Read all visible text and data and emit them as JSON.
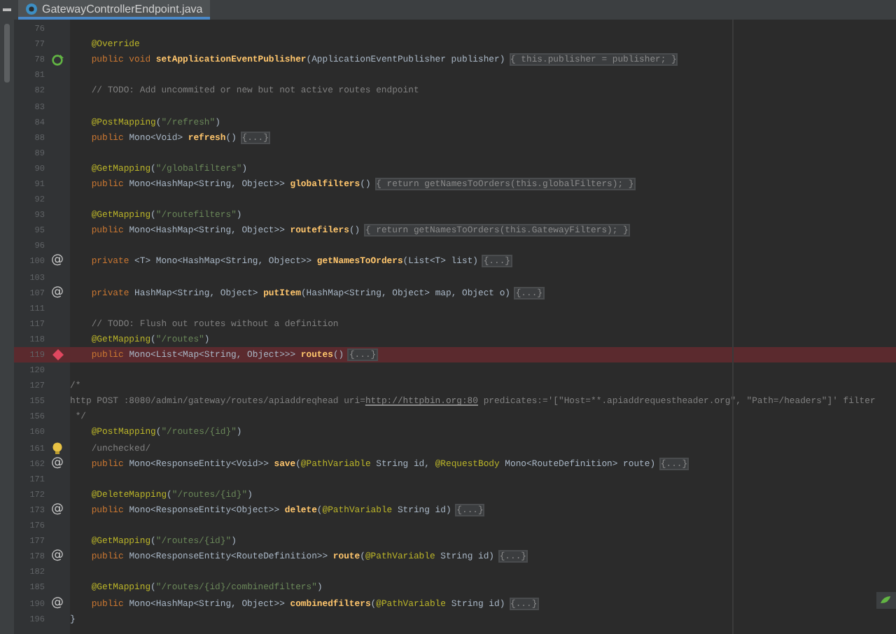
{
  "tabs": [
    {
      "label": "GatewayControllerEndpoint.java",
      "selected": true
    }
  ],
  "lines": [
    {
      "num": "76",
      "highlighted": false
    },
    {
      "num": "77",
      "highlighted": false,
      "tokens": [
        {
          "t": "    @Override",
          "kind": "ann"
        }
      ]
    },
    {
      "num": "78",
      "highlighted": false,
      "gutter": {
        "kind": "override"
      },
      "tokens": [
        {
          "t": "    public void ",
          "kind": "kw"
        },
        {
          "t": "setApplicationEventPublisher",
          "kind": "fn"
        },
        {
          "t": "(ApplicationEventPublisher publisher) ",
          "kind": "p"
        },
        {
          "t": "{ this.publisher = publisher; }",
          "kind": "fold"
        }
      ]
    },
    {
      "num": "81",
      "highlighted": false
    },
    {
      "num": "82",
      "highlighted": false,
      "tokens": [
        {
          "t": "    // TODO: Add uncommited or new but not active routes endpoint",
          "kind": "cm"
        }
      ]
    },
    {
      "num": "83",
      "highlighted": false
    },
    {
      "num": "84",
      "highlighted": false,
      "tokens": [
        {
          "t": "    @PostMapping",
          "kind": "ann"
        },
        {
          "t": "(",
          "kind": "p"
        },
        {
          "t": "\"/refresh\"",
          "kind": "str"
        },
        {
          "t": ")",
          "kind": "p"
        }
      ]
    },
    {
      "num": "88",
      "highlighted": false,
      "tokens": [
        {
          "t": "    public ",
          "kind": "kw"
        },
        {
          "t": "Mono<Void> ",
          "kind": "p"
        },
        {
          "t": "refresh",
          "kind": "fn"
        },
        {
          "t": "() ",
          "kind": "p"
        },
        {
          "t": "{...}",
          "kind": "fold"
        }
      ]
    },
    {
      "num": "89",
      "highlighted": false
    },
    {
      "num": "90",
      "highlighted": false,
      "tokens": [
        {
          "t": "    @GetMapping",
          "kind": "ann"
        },
        {
          "t": "(",
          "kind": "p"
        },
        {
          "t": "\"/globalfilters\"",
          "kind": "str"
        },
        {
          "t": ")",
          "kind": "p"
        }
      ]
    },
    {
      "num": "91",
      "highlighted": false,
      "tokens": [
        {
          "t": "    public ",
          "kind": "kw"
        },
        {
          "t": "Mono<HashMap<String, Object>> ",
          "kind": "p"
        },
        {
          "t": "globalfilters",
          "kind": "fn"
        },
        {
          "t": "() ",
          "kind": "p"
        },
        {
          "t": "{ return getNamesToOrders(this.globalFilters); }",
          "kind": "fold"
        }
      ]
    },
    {
      "num": "92",
      "highlighted": false
    },
    {
      "num": "93",
      "highlighted": false,
      "tokens": [
        {
          "t": "    @GetMapping",
          "kind": "ann"
        },
        {
          "t": "(",
          "kind": "p"
        },
        {
          "t": "\"/routefilters\"",
          "kind": "str"
        },
        {
          "t": ")",
          "kind": "p"
        }
      ]
    },
    {
      "num": "95",
      "highlighted": false,
      "tokens": [
        {
          "t": "    public ",
          "kind": "kw"
        },
        {
          "t": "Mono<HashMap<String, Object>> ",
          "kind": "p"
        },
        {
          "t": "routefilers",
          "kind": "fn"
        },
        {
          "t": "() ",
          "kind": "p"
        },
        {
          "t": "{ return getNamesToOrders(this.GatewayFilters); }",
          "kind": "fold"
        }
      ]
    },
    {
      "num": "96",
      "highlighted": false
    },
    {
      "num": "100",
      "highlighted": false,
      "gutter": {
        "kind": "mapping",
        "glyph": "@"
      },
      "tokens": [
        {
          "t": "    private ",
          "kind": "kw"
        },
        {
          "t": "<T> Mono<HashMap<String, Object>> ",
          "kind": "p"
        },
        {
          "t": "getNamesToOrders",
          "kind": "fn"
        },
        {
          "t": "(List<T> list) ",
          "kind": "p"
        },
        {
          "t": "{...}",
          "kind": "fold"
        }
      ]
    },
    {
      "num": "103",
      "highlighted": false
    },
    {
      "num": "107",
      "highlighted": false,
      "gutter": {
        "kind": "mapping",
        "glyph": "@"
      },
      "tokens": [
        {
          "t": "    private ",
          "kind": "kw"
        },
        {
          "t": "HashMap<String, Object> ",
          "kind": "p"
        },
        {
          "t": "putItem",
          "kind": "fn"
        },
        {
          "t": "(HashMap<String, Object> map, Object o) ",
          "kind": "p"
        },
        {
          "t": "{...}",
          "kind": "fold"
        }
      ]
    },
    {
      "num": "111",
      "highlighted": false
    },
    {
      "num": "117",
      "highlighted": false,
      "tokens": [
        {
          "t": "    // TODO: Flush out routes without a definition",
          "kind": "cm"
        }
      ]
    },
    {
      "num": "118",
      "highlighted": false,
      "tokens": [
        {
          "t": "    @GetMapping",
          "kind": "ann"
        },
        {
          "t": "(",
          "kind": "p"
        },
        {
          "t": "\"/routes\"",
          "kind": "str"
        },
        {
          "t": ")",
          "kind": "p"
        }
      ]
    },
    {
      "num": "119",
      "highlighted": true,
      "gutter": {
        "kind": "breakpoint"
      },
      "tokens": [
        {
          "t": "    public ",
          "kind": "kw"
        },
        {
          "t": "Mono<List<Map<String, Object>>> ",
          "kind": "p"
        },
        {
          "t": "routes",
          "kind": "fn"
        },
        {
          "t": "() ",
          "kind": "p"
        },
        {
          "t": "{...}",
          "kind": "fold"
        }
      ]
    },
    {
      "num": "120",
      "highlighted": false
    },
    {
      "num": "127",
      "highlighted": false,
      "tokens": [
        {
          "t": "/*",
          "kind": "cm"
        }
      ]
    },
    {
      "num": "155",
      "highlighted": false,
      "tokens": [
        {
          "t": "http POST :8080/admin/gateway/routes/apiaddreqhead uri=",
          "kind": "cm"
        },
        {
          "t": "http://httpbin.org:80",
          "kind": "link"
        },
        {
          "t": " predicates:='[\"Host=**.apiaddrequestheader.org\", \"Path=/headers\"]' filter",
          "kind": "cm"
        }
      ]
    },
    {
      "num": "156",
      "highlighted": false,
      "tokens": [
        {
          "t": " */",
          "kind": "cm"
        }
      ]
    },
    {
      "num": "160",
      "highlighted": false,
      "tokens": [
        {
          "t": "    @PostMapping",
          "kind": "ann"
        },
        {
          "t": "(",
          "kind": "p"
        },
        {
          "t": "\"/routes/{id}\"",
          "kind": "str"
        },
        {
          "t": ")",
          "kind": "p"
        }
      ]
    },
    {
      "num": "161",
      "highlighted": false,
      "gutter": {
        "kind": "bulb"
      },
      "tokens": [
        {
          "t": "    /unchecked/",
          "kind": "cm"
        }
      ]
    },
    {
      "num": "162",
      "highlighted": false,
      "gutter": {
        "kind": "mapping",
        "glyph": "@"
      },
      "tokens": [
        {
          "t": "    public ",
          "kind": "kw"
        },
        {
          "t": "Mono<ResponseEntity<Void>> ",
          "kind": "p"
        },
        {
          "t": "save",
          "kind": "fn"
        },
        {
          "t": "(",
          "kind": "p"
        },
        {
          "t": "@PathVariable",
          "kind": "ann"
        },
        {
          "t": " String id, ",
          "kind": "p"
        },
        {
          "t": "@RequestBody",
          "kind": "ann"
        },
        {
          "t": " Mono<RouteDefinition> route) ",
          "kind": "p"
        },
        {
          "t": "{...}",
          "kind": "fold"
        }
      ]
    },
    {
      "num": "171",
      "highlighted": false
    },
    {
      "num": "172",
      "highlighted": false,
      "tokens": [
        {
          "t": "    @DeleteMapping",
          "kind": "ann"
        },
        {
          "t": "(",
          "kind": "p"
        },
        {
          "t": "\"/routes/{id}\"",
          "kind": "str"
        },
        {
          "t": ")",
          "kind": "p"
        }
      ]
    },
    {
      "num": "173",
      "highlighted": false,
      "gutter": {
        "kind": "mapping",
        "glyph": "@"
      },
      "tokens": [
        {
          "t": "    public ",
          "kind": "kw"
        },
        {
          "t": "Mono<ResponseEntity<Object>> ",
          "kind": "p"
        },
        {
          "t": "delete",
          "kind": "fn"
        },
        {
          "t": "(",
          "kind": "p"
        },
        {
          "t": "@PathVariable",
          "kind": "ann"
        },
        {
          "t": " String id) ",
          "kind": "p"
        },
        {
          "t": "{...}",
          "kind": "fold"
        }
      ]
    },
    {
      "num": "176",
      "highlighted": false
    },
    {
      "num": "177",
      "highlighted": false,
      "tokens": [
        {
          "t": "    @GetMapping",
          "kind": "ann"
        },
        {
          "t": "(",
          "kind": "p"
        },
        {
          "t": "\"/routes/{id}\"",
          "kind": "str"
        },
        {
          "t": ")",
          "kind": "p"
        }
      ]
    },
    {
      "num": "178",
      "highlighted": false,
      "gutter": {
        "kind": "mapping",
        "glyph": "@"
      },
      "tokens": [
        {
          "t": "    public ",
          "kind": "kw"
        },
        {
          "t": "Mono<ResponseEntity<RouteDefinition>> ",
          "kind": "p"
        },
        {
          "t": "route",
          "kind": "fn"
        },
        {
          "t": "(",
          "kind": "p"
        },
        {
          "t": "@PathVariable",
          "kind": "ann"
        },
        {
          "t": " String id) ",
          "kind": "p"
        },
        {
          "t": "{...}",
          "kind": "fold"
        }
      ]
    },
    {
      "num": "182",
      "highlighted": false
    },
    {
      "num": "185",
      "highlighted": false,
      "tokens": [
        {
          "t": "    @GetMapping",
          "kind": "ann"
        },
        {
          "t": "(",
          "kind": "p"
        },
        {
          "t": "\"/routes/{id}/combinedfilters\"",
          "kind": "str"
        },
        {
          "t": ")",
          "kind": "p"
        }
      ]
    },
    {
      "num": "190",
      "highlighted": false,
      "gutter": {
        "kind": "mapping",
        "glyph": "@"
      },
      "tokens": [
        {
          "t": "    public ",
          "kind": "kw"
        },
        {
          "t": "Mono<HashMap<String, Object>> ",
          "kind": "p"
        },
        {
          "t": "combinedfilters",
          "kind": "fn"
        },
        {
          "t": "(",
          "kind": "p"
        },
        {
          "t": "@PathVariable",
          "kind": "ann"
        },
        {
          "t": " String id) ",
          "kind": "p"
        },
        {
          "t": "{...}",
          "kind": "fold"
        }
      ]
    },
    {
      "num": "196",
      "highlighted": false,
      "tokens": [
        {
          "t": "}",
          "kind": "p"
        }
      ]
    }
  ]
}
